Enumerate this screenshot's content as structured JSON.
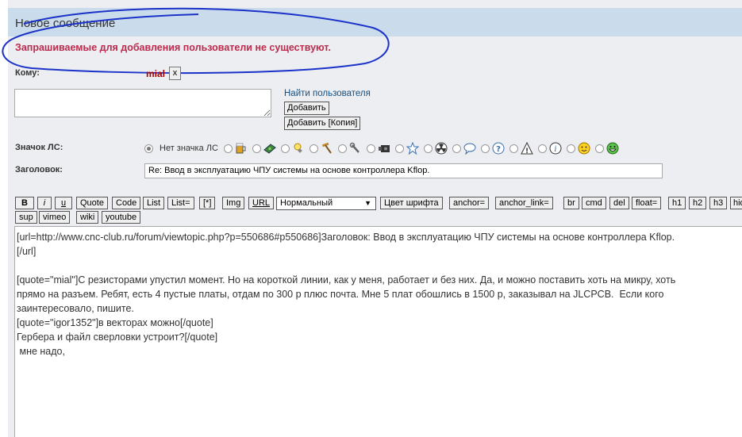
{
  "header": {
    "title": "Новое сообщение"
  },
  "error": {
    "text": "Запрашиваемые для добавления пользователи не существуют."
  },
  "to": {
    "label": "Кому:",
    "recipient": "mial",
    "remove": "x",
    "find_link": "Найти пользователя",
    "add_button": "Добавить",
    "add_copy_button": "Добавить [Копия]"
  },
  "icon": {
    "label": "Значок ЛС:",
    "no_icon": "Нет значка ЛС",
    "icons": [
      "beer-icon",
      "money-icon",
      "lightbulb-icon",
      "hammer-icon",
      "wrench-icon",
      "camera-icon",
      "star-icon",
      "radiation-icon",
      "speech-bubble-icon",
      "question-icon",
      "warning-icon",
      "info-icon",
      "smile-icon",
      "grin-icon"
    ]
  },
  "subject": {
    "label": "Заголовок:",
    "value": "Re: Ввод в эксплуатацию ЧПУ системы на основе контроллера Kflop."
  },
  "toolbar": {
    "row1": [
      "B",
      "i",
      "u",
      "Quote",
      "Code",
      "List",
      "List=",
      "[*]",
      "Img",
      "URL"
    ],
    "font_size": "Нормальный",
    "row1b": [
      "Цвет шрифта",
      "anchor=",
      "anchor_link=",
      "br",
      "cmd",
      "del",
      "float=",
      "h1",
      "h2",
      "h3",
      "hide"
    ],
    "row2": [
      "sup",
      "vimeo",
      "wiki",
      "youtube"
    ]
  },
  "editor": {
    "text": "[url=http://www.cnc-club.ru/forum/viewtopic.php?p=550686#p550686]Заголовок: Ввод в эксплуатацию ЧПУ системы на основе контроллера Kflop.\n[/url]\n\n[quote=\"mial\"]С резисторами упустил момент. Но на короткой линии, как у меня, работает и без них. Да, и можно поставить хоть на микру, хоть\nпрямо на разъем. Ребят, есть 4 пустые платы, отдам по 300 р плюс почта. Мне 5 плат обошлись в 1500 р, заказывал на JLCPCB.  Если кого\nзаинтересовало, пишите.\n[quote=\"igor1352\"]в векторах можно[/quote]\nГербера и файл сверловки устроит?[/quote]\n мне надо,"
  }
}
